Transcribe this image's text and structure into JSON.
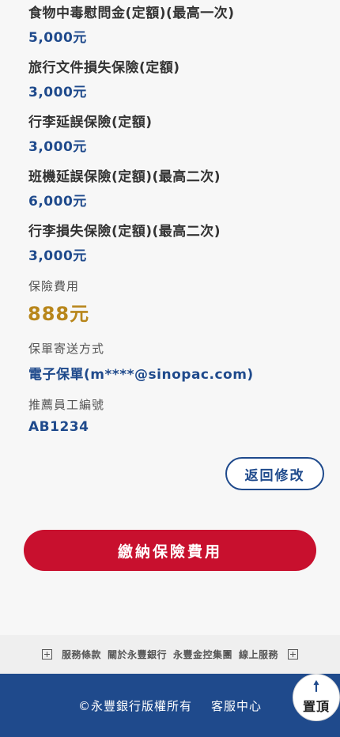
{
  "coverage_items": [
    {
      "title": "食物中毒慰問金(定額)(最高一次)",
      "value": "5,000元"
    },
    {
      "title": "旅行文件損失保險(定額)",
      "value": "3,000元"
    },
    {
      "title": "行李延誤保險(定額)",
      "value": "3,000元"
    },
    {
      "title": "班機延誤保險(定額)(最高二次)",
      "value": "6,000元"
    },
    {
      "title": "行李損失保險(定額)(最高二次)",
      "value": "3,000元"
    }
  ],
  "fee": {
    "label": "保險費用",
    "value": "888元"
  },
  "delivery": {
    "label": "保單寄送方式",
    "value": "電子保單(m****@sinopac.com)"
  },
  "referrer": {
    "label": "推薦員工編號",
    "value": "AB1234"
  },
  "buttons": {
    "back": "返回修改",
    "pay": "繳納保險費用",
    "top": "置頂"
  },
  "footer_links": [
    "服務條款",
    "關於永豐銀行",
    "永豐金控集團",
    "線上服務"
  ],
  "footer": {
    "copyright": "©永豐銀行版權所有",
    "service": "客服中心"
  },
  "colors": {
    "brand_blue": "#1f4a8c",
    "pay_red": "#c8102e",
    "fee_gold": "#b8861b"
  },
  "icons": {
    "expand": "plus-box-icon",
    "top": "arrow-up-icon"
  }
}
